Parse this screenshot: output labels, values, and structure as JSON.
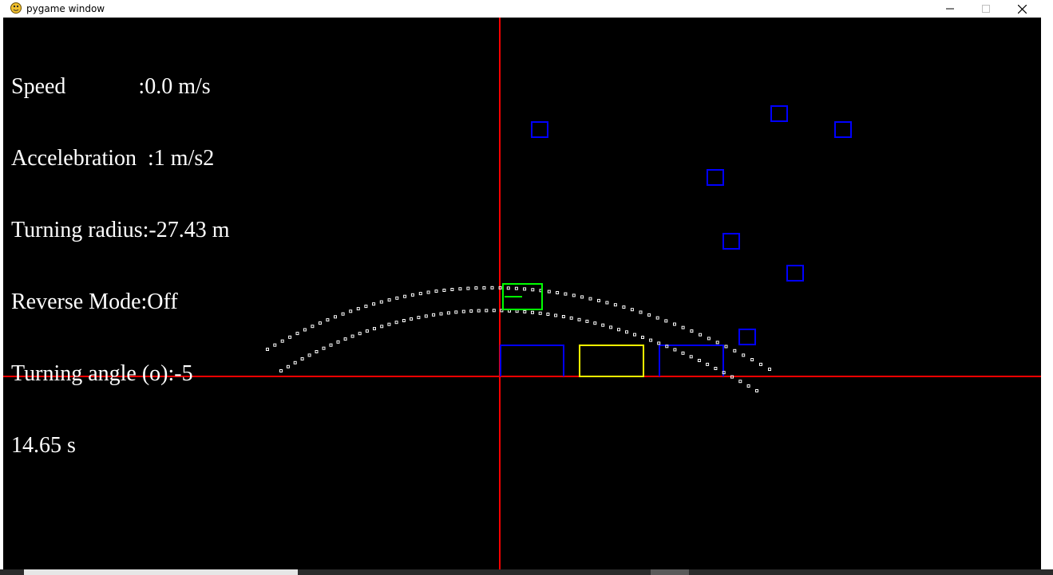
{
  "window": {
    "title": "pygame window",
    "icon": "pygame-snake-icon",
    "controls": [
      "minimize-icon",
      "maximize-icon",
      "close-icon"
    ]
  },
  "hud": {
    "speed": "Speed             :0.0 m/s",
    "acceleration": "Accelebration  :1 m/s2",
    "turning_radius": "Turning radius:-27.43 m",
    "reverse_mode": "Reverse Mode:Off",
    "turning_angle": "Turning angle (o):-5",
    "elapsed_time": "14.65 s"
  },
  "colors": {
    "background": "#000000",
    "axes": "#ff0000",
    "obstacle": "#0000ff",
    "parking_spot": "#ffff00",
    "car": "#00ff00",
    "trajectory": "#ffffff",
    "hud_text": "#ffffff"
  }
}
